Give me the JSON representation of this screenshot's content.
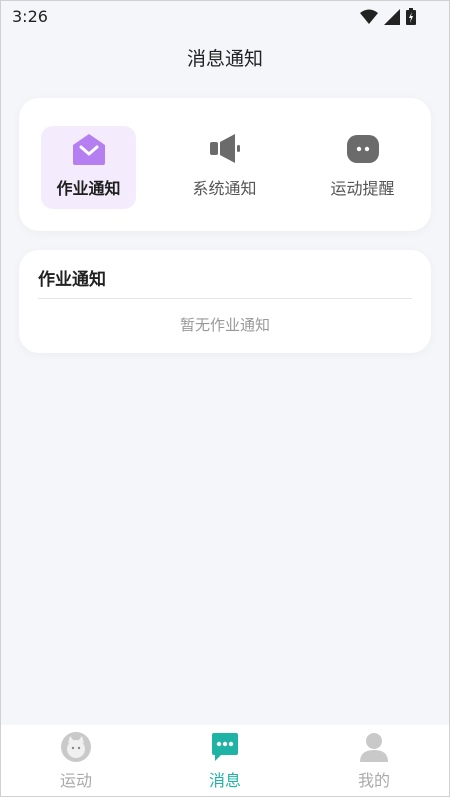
{
  "status_bar": {
    "time": "3:26"
  },
  "header": {
    "title": "消息通知"
  },
  "tabs": [
    {
      "label": "作业通知",
      "icon": "envelope-icon",
      "active": true
    },
    {
      "label": "系统通知",
      "icon": "megaphone-icon",
      "active": false
    },
    {
      "label": "运动提醒",
      "icon": "chat-bubble-icon",
      "active": false
    }
  ],
  "list": {
    "title": "作业通知",
    "empty_text": "暂无作业通知"
  },
  "bottom_nav": [
    {
      "label": "运动",
      "icon": "cat-avatar-icon",
      "active": false
    },
    {
      "label": "消息",
      "icon": "message-icon",
      "active": true
    },
    {
      "label": "我的",
      "icon": "person-icon",
      "active": false
    }
  ],
  "colors": {
    "accent_purple": "#b57ef1",
    "active_tab_bg": "#f4ecfd",
    "nav_active": "#1fb3a5",
    "background": "#f5f6fa"
  }
}
